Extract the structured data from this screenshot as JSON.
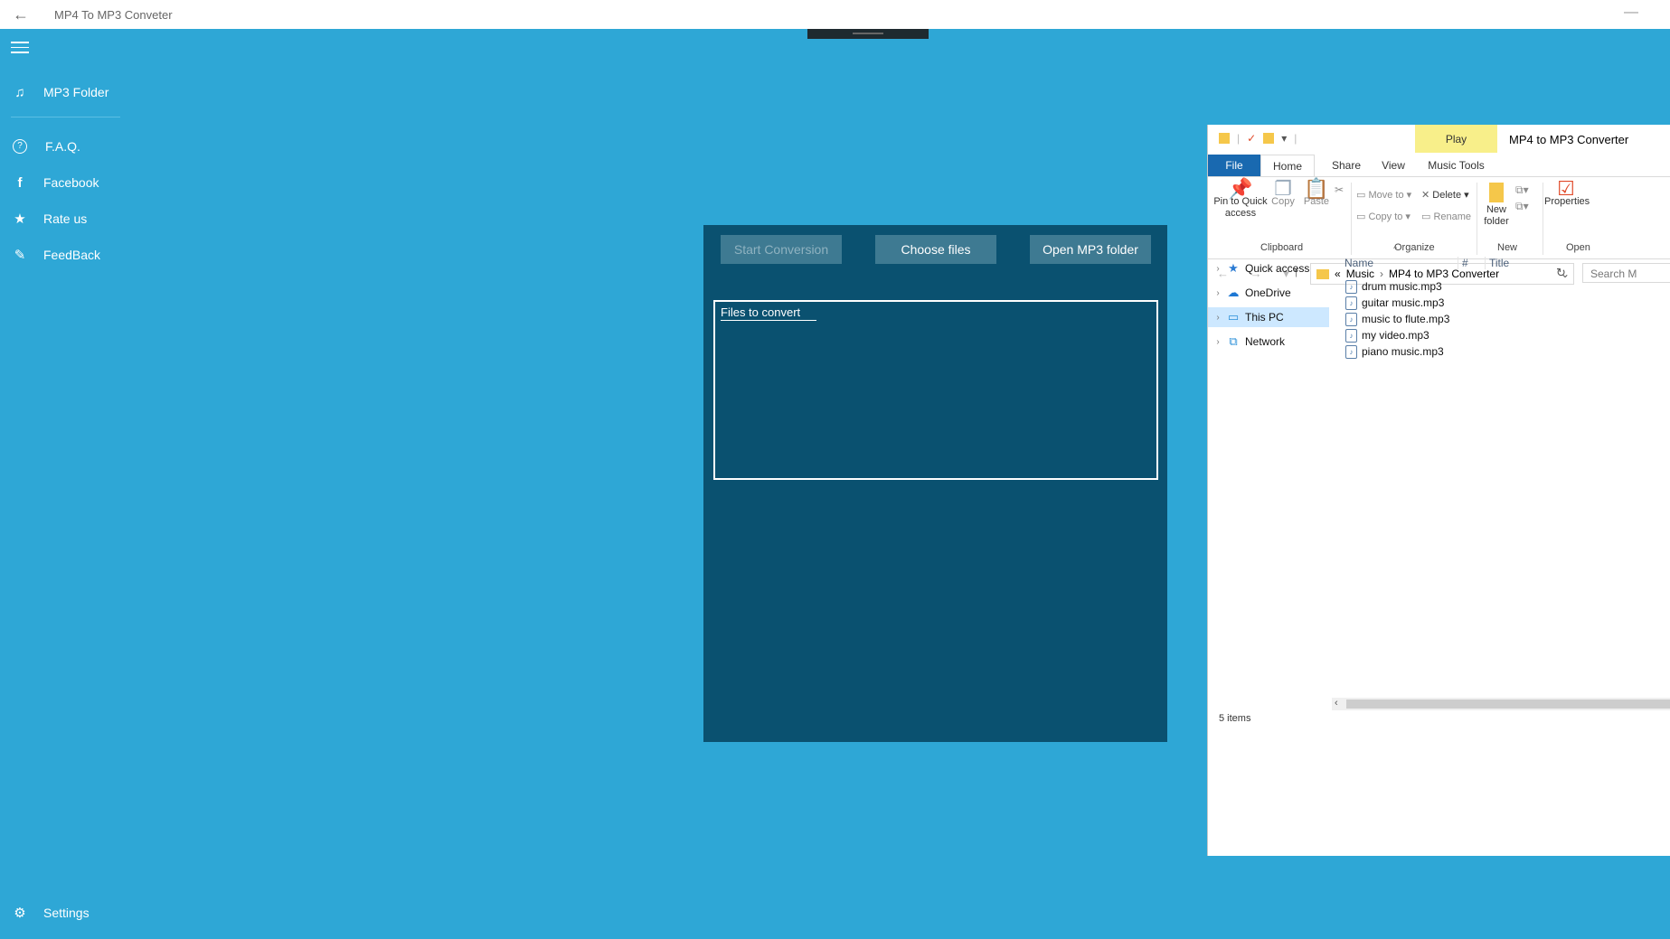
{
  "app": {
    "title": "MP4 To MP3 Conveter",
    "back_icon": "←",
    "minimize_icon": "—"
  },
  "sidebar": {
    "items": [
      {
        "icon": "♫",
        "label": "MP3 Folder"
      },
      {
        "icon": "?",
        "label": "F.A.Q."
      },
      {
        "icon": "f",
        "label": "Facebook"
      },
      {
        "icon": "★",
        "label": "Rate us"
      },
      {
        "icon": "✎",
        "label": "FeedBack"
      }
    ],
    "settings": {
      "icon": "⚙",
      "label": "Settings"
    }
  },
  "panel": {
    "start_conversion": "Start Conversion",
    "choose_files": "Choose files",
    "open_mp3_folder": "Open MP3 folder",
    "files_label": "Files to convert"
  },
  "explorer": {
    "play_tab": "Play",
    "window_title": "MP4 to MP3 Converter",
    "tabs": [
      "File",
      "Home",
      "Share",
      "View",
      "Music Tools"
    ],
    "ribbon": {
      "pin": "Pin to Quick access",
      "copy": "Copy",
      "paste": "Paste",
      "move_to": "Move to",
      "copy_to": "Copy to",
      "delete": "Delete",
      "rename": "Rename",
      "new_folder": "New folder",
      "properties": "Properties",
      "groups": [
        "Clipboard",
        "Organize",
        "New",
        "Open"
      ]
    },
    "address": {
      "prefix": "«",
      "crumbs": [
        "Music",
        "MP4 to MP3 Converter"
      ],
      "separator": "›",
      "search_placeholder": "Search M"
    },
    "tree": [
      "Quick access",
      "OneDrive",
      "This PC",
      "Network"
    ],
    "columns": [
      "Name",
      "#",
      "Title"
    ],
    "files": [
      "drum music.mp3",
      "guitar music.mp3",
      "music to flute.mp3",
      "my video.mp3",
      "piano music.mp3"
    ],
    "status": "5 items"
  },
  "colors": {
    "background": "#2ea7d6",
    "panel": "#0a5170",
    "button": "#3e7a92",
    "file_tab": "#1969b0",
    "play_tab": "#f8ef8a",
    "selected_tree": "#cde8ff"
  }
}
